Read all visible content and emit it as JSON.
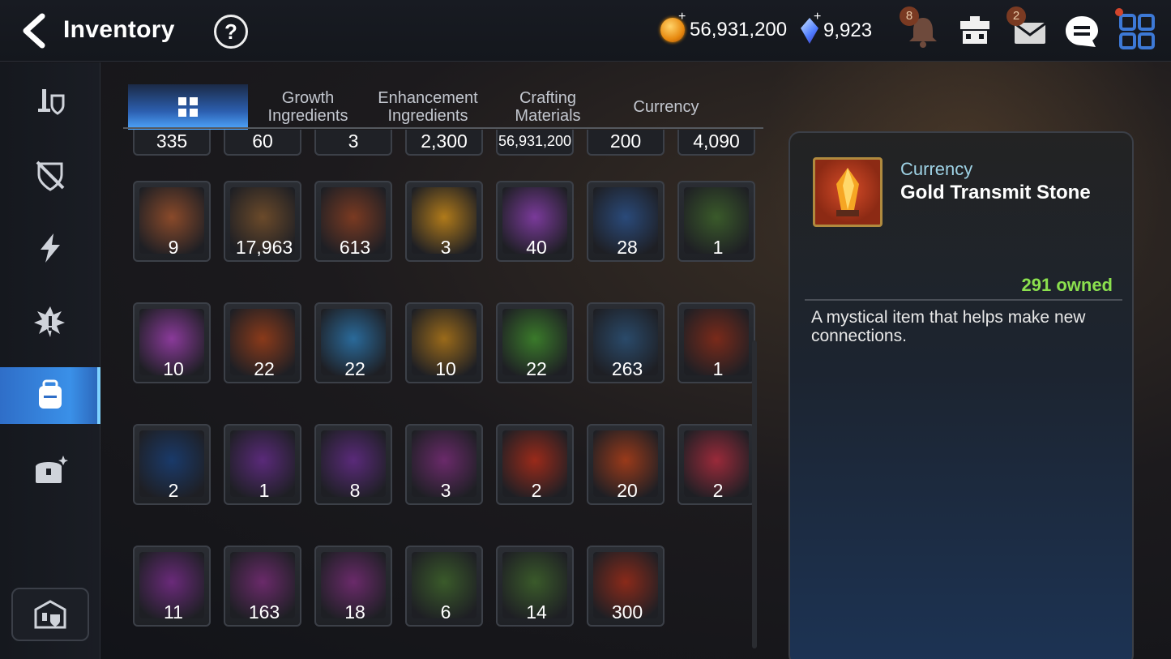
{
  "header": {
    "title": "Inventory",
    "help": "?",
    "gold": "56,931,200",
    "gems": "9,923",
    "notifications_badge": "8",
    "mail_badge": "2"
  },
  "icons": {
    "back": "back-arrow-icon",
    "help": "help-icon",
    "gold": "gold-coin-icon",
    "gem": "crystal-gem-icon",
    "bell": "bell-icon",
    "shop": "shop-icon",
    "mail": "mail-icon",
    "chat": "chat-icon",
    "menu": "grid-menu-icon"
  },
  "sidebar": {
    "items": [
      {
        "name": "equipment-icon",
        "active": false
      },
      {
        "name": "unequip-icon",
        "active": false
      },
      {
        "name": "skill-icon",
        "active": false
      },
      {
        "name": "catalyst-icon",
        "active": false
      },
      {
        "name": "backpack-icon",
        "active": true
      },
      {
        "name": "chest-icon",
        "active": false
      }
    ]
  },
  "tabs": [
    {
      "label": "",
      "active": true
    },
    {
      "label": "Growth\nIngredients",
      "active": false
    },
    {
      "label": "Enhancement\nIngredients",
      "active": false
    },
    {
      "label": "Crafting\nMaterials",
      "active": false
    },
    {
      "label": "Currency",
      "active": false
    }
  ],
  "partial_row": [
    "335",
    "60",
    "3",
    "2,300",
    "56,931,200",
    "200",
    "4,090"
  ],
  "grid": [
    [
      {
        "qty": "9",
        "icon": "flag-icon",
        "color": "#8a4a2a"
      },
      {
        "qty": "17,963",
        "icon": "horse-statue-icon",
        "color": "#6b4a2a"
      },
      {
        "qty": "613",
        "icon": "red-leaf-icon",
        "color": "#7a3a22"
      },
      {
        "qty": "3",
        "icon": "mascot-face-icon",
        "color": "#b07a1a"
      },
      {
        "qty": "40",
        "icon": "purple-flower-icon",
        "color": "#7a3a9a"
      },
      {
        "qty": "28",
        "icon": "gold-flower-icon",
        "color": "#2a4a7a"
      },
      {
        "qty": "1",
        "icon": "white-flower-icon",
        "color": "#3a5a2a"
      }
    ],
    [
      {
        "qty": "10",
        "icon": "purple-rune-icon",
        "color": "#8a3a9a"
      },
      {
        "qty": "22",
        "icon": "fire-rune-icon",
        "color": "#8a3a1a"
      },
      {
        "qty": "22",
        "icon": "ice-rune-icon",
        "color": "#2a6a9a"
      },
      {
        "qty": "10",
        "icon": "light-rune-icon",
        "color": "#9a6a1a"
      },
      {
        "qty": "22",
        "icon": "earth-rune-icon",
        "color": "#3a7a2a"
      },
      {
        "qty": "263",
        "icon": "ginseng-icon",
        "color": "#2a4a6a"
      },
      {
        "qty": "1",
        "icon": "green-orb-icon",
        "color": "#7a2a1a"
      }
    ],
    [
      {
        "qty": "2",
        "icon": "blue-portal-icon",
        "color": "#1a3a6a"
      },
      {
        "qty": "1",
        "icon": "pet-package-icon",
        "color": "#5a2a7a"
      },
      {
        "qty": "8",
        "icon": "pet-package-icon",
        "color": "#5a2a7a"
      },
      {
        "qty": "3",
        "icon": "feather-duster-icon",
        "color": "#6a2a6a"
      },
      {
        "qty": "2",
        "icon": "red-stone-icon",
        "color": "#9a2a1a"
      },
      {
        "qty": "20",
        "icon": "red-hammer-stone-icon",
        "color": "#9a3a1a"
      },
      {
        "qty": "2",
        "icon": "pink-potion-icon",
        "color": "#9a2a3a"
      }
    ],
    [
      {
        "qty": "11",
        "icon": "blue-cross-stone-icon",
        "color": "#6a2a7a"
      },
      {
        "qty": "163",
        "icon": "gold-hammer-stone-icon",
        "color": "#6a2a6a"
      },
      {
        "qty": "18",
        "icon": "lightning-stone-icon",
        "color": "#6a2a6a"
      },
      {
        "qty": "6",
        "icon": "blue-cross-white-stone-icon",
        "color": "#3a5a2a"
      },
      {
        "qty": "14",
        "icon": "lightning-white-stone-icon",
        "color": "#3a5a2a"
      },
      {
        "qty": "300",
        "icon": "blue-feather-icon",
        "color": "#8a2a1a"
      }
    ]
  ],
  "detail": {
    "category": "Currency",
    "name": "Gold Transmit Stone",
    "owned": "291 owned",
    "description": "A mystical item that helps make new connections.",
    "icon": "gold-transmit-stone-icon"
  }
}
